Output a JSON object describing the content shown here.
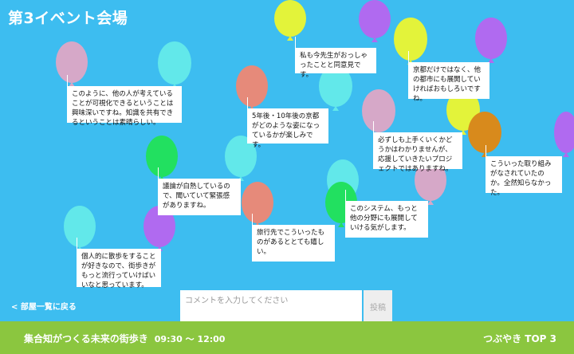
{
  "header": {
    "title": "第3イベント会場"
  },
  "balloons": {
    "b1": {
      "color": "#d6a8c8"
    },
    "b2": {
      "color": "#62e8ea"
    },
    "b3": {
      "color": "#e3f33a"
    },
    "b4": {
      "color": "#b06af0"
    },
    "b5": {
      "color": "#e3f33a"
    },
    "b6": {
      "color": "#b06af0"
    },
    "b7": {
      "color": "#e68a7a"
    },
    "b8": {
      "color": "#62e8ea"
    },
    "b9": {
      "color": "#d6a8c8"
    },
    "b10": {
      "color": "#e3f33a"
    },
    "b11": {
      "color": "#d88a1c"
    },
    "b12": {
      "color": "#b06af0"
    },
    "b13": {
      "color": "#22e060"
    },
    "b14": {
      "color": "#62e8ea"
    },
    "b15": {
      "color": "#e68a7a"
    },
    "b16": {
      "color": "#62e8ea"
    },
    "b17": {
      "color": "#22e060"
    },
    "b18": {
      "color": "#d6a8c8"
    },
    "b19": {
      "color": "#62e8ea"
    },
    "b20": {
      "color": "#b06af0"
    }
  },
  "comments": {
    "c1": {
      "text": "私も今先生がおっしゃったことと同意見です。"
    },
    "c2": {
      "text": "京都だけではなく、他の都市にも展開していければおもしろいですね。"
    },
    "c3": {
      "text": "このように、他の人が考えていることが可視化できるということは興味深いですね。知識を共有できるということは素晴らしい。"
    },
    "c4": {
      "text": "5年後・10年後の京都がどのような姿になっているかが楽しみです。"
    },
    "c5": {
      "text": "必ずしも上手くいくかどうかはわかりませんが、応援していきたいプロジェクトではありますね。"
    },
    "c6": {
      "text": "こういった取り組みがなされていたのか。全然知らなかった。"
    },
    "c7": {
      "text": "議論が白熱しているので、聞いていて緊張感がありますね。"
    },
    "c8": {
      "text": "このシステム、もっと他の分野にも展開していける気がします。"
    },
    "c9": {
      "text": "旅行先でこういったものがあるととても嬉しい。"
    },
    "c10": {
      "text": "個人的に散歩をすることが好きなので、街歩きがもっと流行っていけばいいなと思っています。"
    }
  },
  "nav": {
    "back_label": "< 部屋一覧に戻る"
  },
  "composer": {
    "placeholder": "コメントを入力してください",
    "post_label": "投稿"
  },
  "footer": {
    "event_title": "集合知がつくる未来の街歩き",
    "time": "09:30 〜 12:00",
    "top3_label": "つぶやき TOP 3"
  }
}
